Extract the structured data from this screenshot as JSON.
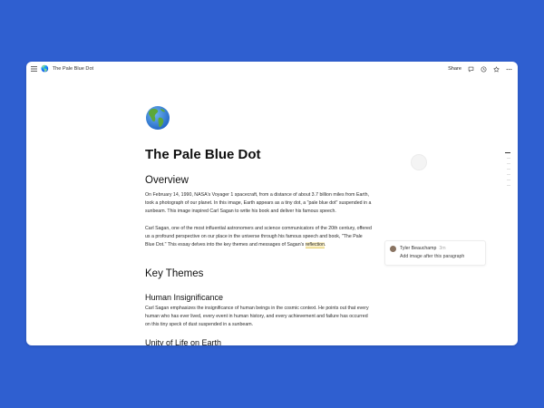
{
  "topbar": {
    "page_icon": "🌎",
    "page_title": "The Pale Blue Dot",
    "share_label": "Share",
    "icons": [
      "menu-icon",
      "comment-icon",
      "history-icon",
      "star-icon",
      "more-icon"
    ]
  },
  "page": {
    "icon": "earth-globe-americas",
    "title": "The Pale Blue Dot",
    "overview_heading": "Overview",
    "overview_p1": "On February 14, 1990, NASA's Voyager 1 spacecraft, from a distance of about 3.7 billion miles from Earth, took a photograph of our planet. In this image, Earth appears as a tiny dot, a \"pale blue dot\" suspended in a sunbeam. This image inspired Carl Sagan to write his book and deliver his famous speech.",
    "overview_p2_before": "Carl Sagan, one of the most influential astronomers and science communicators of the 20th century, offered us a profound perspective on our place in the universe through his famous speech and book, \"The Pale Blue Dot.\" This essay delves into the key themes and messages of Sagan's ",
    "overview_p2_highlight": "reflection",
    "overview_p2_after": ".",
    "key_themes_heading": "Key Themes",
    "human_insignificance_heading": "Human Insignificance",
    "human_insignificance_p": "Carl Sagan emphasizes the insignificance of human beings in the cosmic context. He points out that every human who has ever lived, every event in human history, and every achievement and failure has occurred on this tiny speck of dust suspended in a sunbeam.",
    "unity_heading": "Unity of Life on Earth"
  },
  "comment": {
    "author": "Tyler Beauchamp",
    "time": "3m",
    "text": "Add image after this paragraph"
  },
  "colors": {
    "background": "#2f5fd0",
    "window": "#ffffff",
    "highlight": "#fbf1c9"
  }
}
